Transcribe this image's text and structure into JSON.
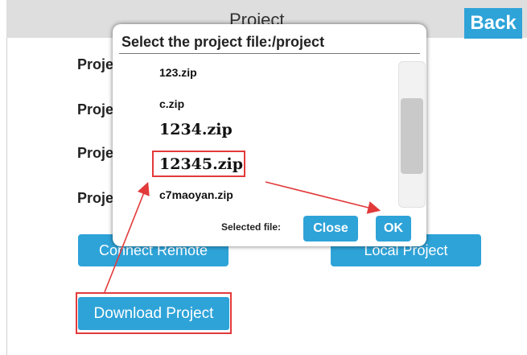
{
  "header": {
    "title": "Project",
    "back_label": "Back"
  },
  "background": {
    "labels": [
      "Proje",
      "Proje",
      "Proje",
      "Proje"
    ],
    "connect_remote_label": "Connect Remote",
    "local_project_label": "Local Project",
    "download_project_label": "Download Project"
  },
  "dialog": {
    "title": "Select the project file:/project",
    "files": [
      "123.zip",
      "c.zip",
      "1234.zip",
      "12345.zip",
      "c7maoyan.zip"
    ],
    "selected_file_label": "Selected file:",
    "close_label": "Close",
    "ok_label": "OK"
  },
  "colors": {
    "accent": "#2ea3d8",
    "highlight": "#e23a3a"
  },
  "icons": [
    "arrow-annotation-icon"
  ]
}
